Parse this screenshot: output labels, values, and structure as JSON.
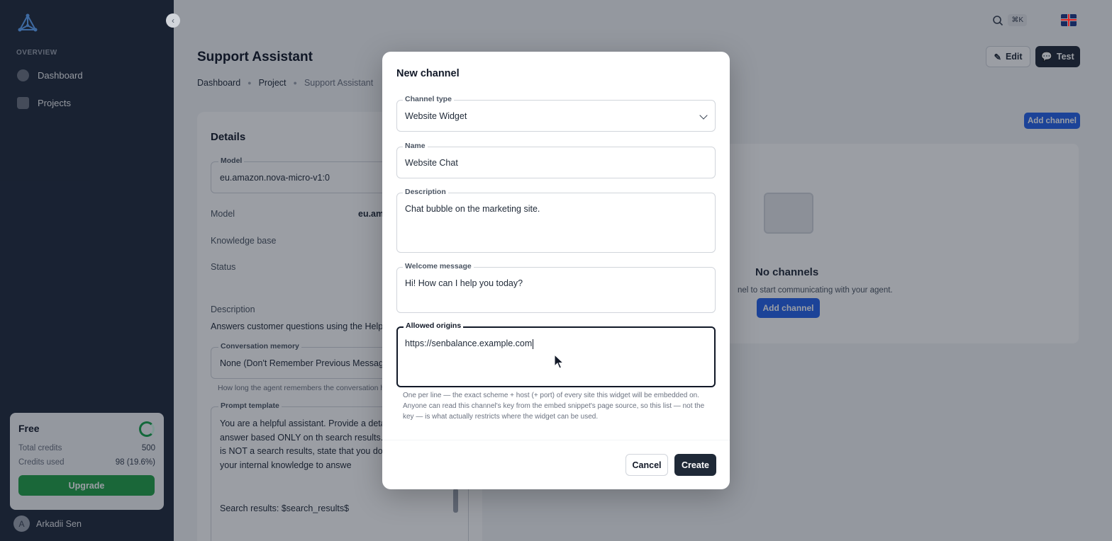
{
  "sidebar": {
    "section_label": "OVERVIEW",
    "items": [
      {
        "label": "Dashboard"
      },
      {
        "label": "Projects"
      }
    ],
    "plan": {
      "name": "Free",
      "total_credits_label": "Total credits",
      "total_credits_value": "500",
      "credits_used_label": "Credits used",
      "credits_used_value": "98 (19.6%)",
      "upgrade_label": "Upgrade"
    },
    "user": {
      "initial": "A",
      "name": "Arkadii Sen"
    }
  },
  "topbar": {
    "shortcut": "⌘K"
  },
  "page": {
    "title": "Support Assistant",
    "breadcrumbs": [
      "Dashboard",
      "Project",
      "Support Assistant"
    ],
    "edit_label": "Edit",
    "test_label": "Test"
  },
  "details": {
    "title": "Details",
    "model_label": "Model",
    "model_value": "eu.amazon.nova-micro-v1:0",
    "rows": [
      {
        "key": "Model",
        "value": "eu.am"
      },
      {
        "key": "Knowledge base",
        "value": ""
      },
      {
        "key": "Status",
        "value": ""
      }
    ],
    "description_label": "Description",
    "description_value": "Answers customer questions using the Help C",
    "memory_label": "Conversation memory",
    "memory_value": "None (Don't Remember Previous Messag",
    "memory_help": "How long the agent remembers the conversation h",
    "prompt_label": "Prompt template",
    "prompt_value": "You are a helpful assistant. Provide a deta comprehensive answer based ONLY on th search results. If the information is NOT a search results, state that you don't know not use your internal knowledge to answe",
    "prompt_tail": "Search results: $search_results$"
  },
  "channels": {
    "add_label": "Add channel",
    "empty_title": "No channels",
    "empty_sub": "nel to start communicating with your agent.",
    "add_mid_label": "Add channel"
  },
  "modal": {
    "title": "New channel",
    "channel_type_label": "Channel type",
    "channel_type_value": "Website Widget",
    "name_label": "Name",
    "name_value": "Website Chat",
    "description_label": "Description",
    "description_value": "Chat bubble on the marketing site.",
    "welcome_label": "Welcome message",
    "welcome_value": "Hi! How can I help you today?",
    "origins_label": "Allowed origins",
    "origins_value": "https://senbalance.example.com",
    "origins_help": "One per line — the exact scheme + host (+ port) of every site this widget will be embedded on. Anyone can read this channel's key from the embed snippet's page source, so this list — not the key — is what actually restricts where the widget can be used.",
    "cancel_label": "Cancel",
    "create_label": "Create"
  },
  "colors": {
    "sidebar_bg": "#1f2a3c",
    "primary": "#2563eb",
    "upgrade": "#22a048",
    "dark_button": "#1f2937"
  }
}
